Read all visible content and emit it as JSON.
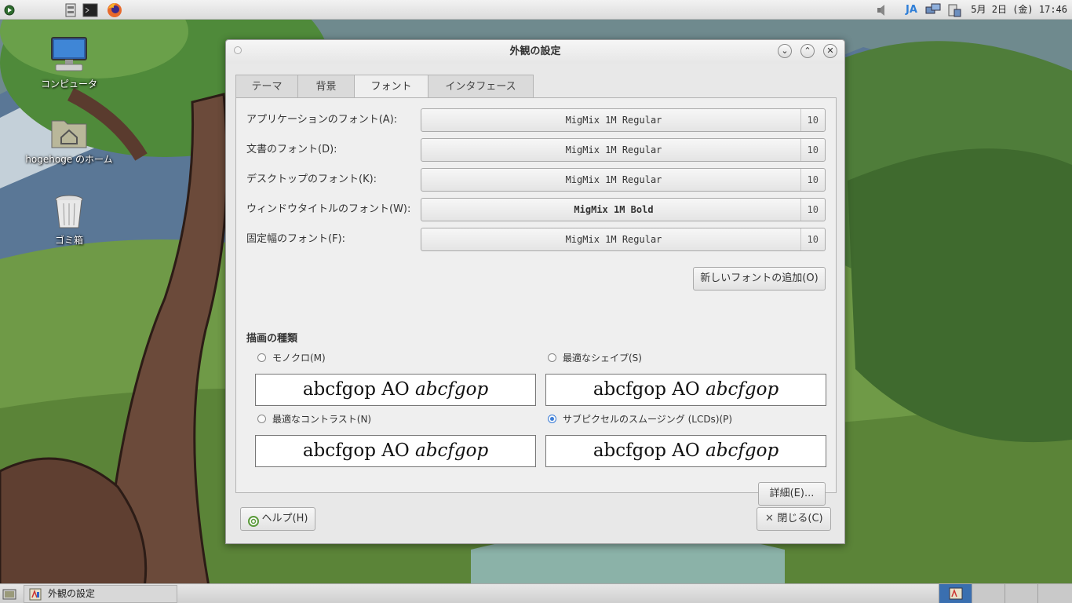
{
  "top_panel": {
    "clock": "5月 2日 (金) 17:46",
    "ime": "JA",
    "icons": [
      "menu-icon",
      "file-manager-icon",
      "terminal-icon",
      "firefox-icon",
      "volume-icon",
      "network-icon",
      "clipboard-icon"
    ]
  },
  "desktop": {
    "icons": [
      {
        "label": "コンピュータ",
        "icon": "computer-icon"
      },
      {
        "label": "hogehoge のホーム",
        "icon": "home-folder-icon"
      },
      {
        "label": "ゴミ箱",
        "icon": "trash-icon"
      }
    ]
  },
  "dialog": {
    "title": "外観の設定",
    "tabs": [
      {
        "label": "テーマ"
      },
      {
        "label": "背景"
      },
      {
        "label": "フォント",
        "active": true
      },
      {
        "label": "インタフェース"
      }
    ],
    "fonts": [
      {
        "label": "アプリケーションのフォント(A):",
        "font": "MigMix 1M Regular",
        "size": "10",
        "bold": false
      },
      {
        "label": "文書のフォント(D):",
        "font": "MigMix 1M Regular",
        "size": "10",
        "bold": false
      },
      {
        "label": "デスクトップのフォント(K):",
        "font": "MigMix 1M Regular",
        "size": "10",
        "bold": false
      },
      {
        "label": "ウィンドウタイトルのフォント(W):",
        "font": "MigMix 1M Bold",
        "size": "10",
        "bold": true
      },
      {
        "label": "固定幅のフォント(F):",
        "font": "MigMix 1M Regular",
        "size": "10",
        "bold": false
      }
    ],
    "add_font_button": "新しいフォントの追加(O)",
    "rendering": {
      "title": "描画の種類",
      "options": [
        {
          "label": "モノクロ(M)",
          "selected": false
        },
        {
          "label": "最適なシェイプ(S)",
          "selected": false
        },
        {
          "label": "最適なコントラスト(N)",
          "selected": false
        },
        {
          "label": "サブピクセルのスムージング (LCDs)(P)",
          "selected": true
        }
      ],
      "preview_regular": "abcfgop AO ",
      "preview_italic": "abcfgop"
    },
    "details_button": "詳細(E)...",
    "help_button": "ヘルプ(H)",
    "close_button": "閉じる(C)"
  },
  "taskbar": {
    "task_label": "外観の設定"
  }
}
